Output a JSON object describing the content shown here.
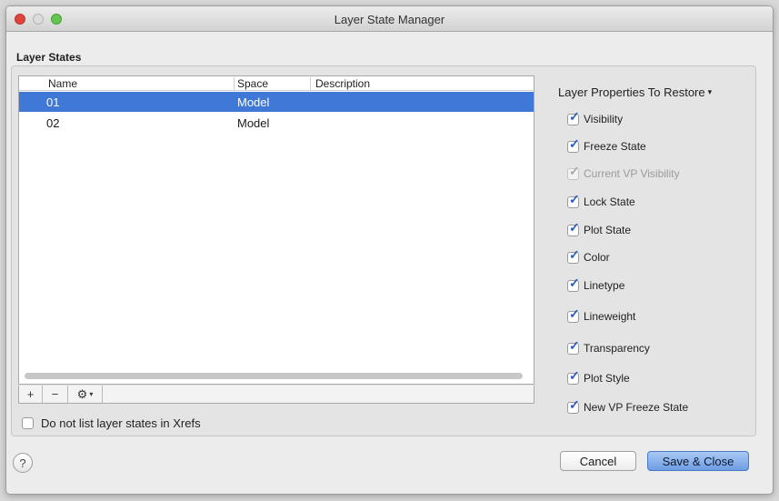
{
  "window": {
    "title": "Layer State Manager"
  },
  "layer_states": {
    "label": "Layer States",
    "columns": [
      "Name",
      "Space",
      "Description"
    ],
    "rows": [
      {
        "name": "01",
        "space": "Model",
        "description": "",
        "selected": true
      },
      {
        "name": "02",
        "space": "Model",
        "description": "",
        "selected": false
      }
    ],
    "toolbar": {
      "add": "+",
      "remove": "−",
      "gear": "⚙",
      "gear_caret": "▾"
    }
  },
  "xrefs_checkbox": {
    "label": "Do not list layer states in Xrefs",
    "checked": false
  },
  "restore": {
    "header": "Layer Properties To Restore",
    "caret": "▾",
    "properties": [
      {
        "label": "Visibility",
        "checked": true,
        "enabled": true
      },
      {
        "label": "Freeze State",
        "checked": true,
        "enabled": true
      },
      {
        "label": "Current VP Visibility",
        "checked": true,
        "enabled": false
      },
      {
        "label": "Lock State",
        "checked": true,
        "enabled": true
      },
      {
        "label": "Plot State",
        "checked": true,
        "enabled": true
      },
      {
        "label": "Color",
        "checked": true,
        "enabled": true
      },
      {
        "label": "Linetype",
        "checked": true,
        "enabled": true
      },
      {
        "label": "Lineweight",
        "checked": true,
        "enabled": true
      },
      {
        "label": "Transparency",
        "checked": true,
        "enabled": true
      },
      {
        "label": "Plot Style",
        "checked": true,
        "enabled": true
      },
      {
        "label": "New VP Freeze State",
        "checked": true,
        "enabled": true
      }
    ]
  },
  "footer": {
    "help": "?",
    "cancel": "Cancel",
    "save": "Save & Close"
  },
  "colors": {
    "selection": "#3f78d6",
    "check": "#2a5bbd",
    "primary_button": "#6f9de3"
  }
}
